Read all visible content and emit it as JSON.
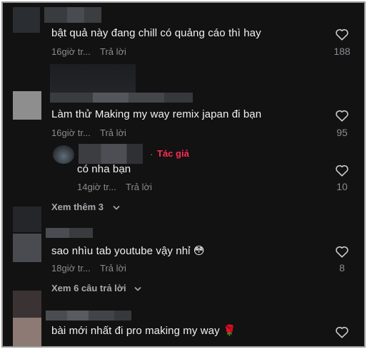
{
  "comments": [
    {
      "text": "bật quả này đang chill có quảng cáo thì hay",
      "time": "16giờ tr...",
      "reply_label": "Trả lời",
      "likes": "188"
    },
    {
      "text": "Làm thử Making my way remix japan đi bạn",
      "time": "16giờ tr...",
      "reply_label": "Trả lời",
      "likes": "95",
      "replies": [
        {
          "author_badge": "Tác giả",
          "text": "có nha bạn",
          "time": "14giờ tr...",
          "reply_label": "Trả lời",
          "likes": "10"
        }
      ],
      "view_more": "Xem thêm 3"
    },
    {
      "text": "sao nhìu tab youtube vậy nhỉ 😳",
      "time": "18giờ tr...",
      "reply_label": "Trả lời",
      "likes": "8",
      "view_more": "Xem 6 câu trả lời"
    },
    {
      "text": "bài mới nhất đi pro making my way 🌹",
      "likes": ""
    }
  ],
  "colors": {
    "background": "#121212",
    "text": "#f1f1f2",
    "muted": "#8a8b91",
    "author": "#fe2c55"
  },
  "icons": {
    "like": "heart-outline-icon",
    "expand": "chevron-down-icon"
  }
}
